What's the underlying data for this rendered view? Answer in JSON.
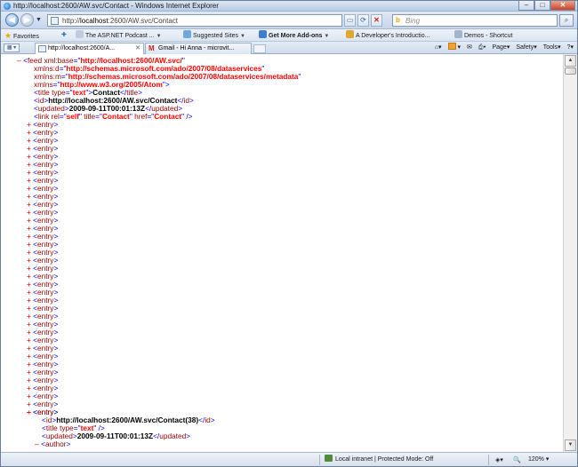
{
  "window": {
    "title": "http://localhost:2600/AW.svc/Contact - Windows Internet Explorer",
    "minimize": "–",
    "maximize": "□",
    "close": "✕"
  },
  "address": {
    "url_prefix": "http://",
    "url_host": "localhost",
    "url_rest": ":2600/AW.svc/Contact",
    "search_placeholder": "Bing"
  },
  "favorites": {
    "favorites_label": "Favorites",
    "items": [
      {
        "label": "The ASP.NET Podcast ...",
        "icon": "podcast-icon"
      },
      {
        "label": "Suggested Sites",
        "icon": "suggested-sites-icon"
      },
      {
        "label": "Get More Add-ons",
        "icon": "addons-icon"
      },
      {
        "label": "A Developer's Introductio...",
        "icon": "page-icon"
      },
      {
        "label": "Demos - Shortcut",
        "icon": "page-icon"
      }
    ]
  },
  "tabs": [
    {
      "label": "http://localhost:2600/A...",
      "active": true
    },
    {
      "label": "Gmail - Hi Anna - microvit...",
      "active": false
    }
  ],
  "commands": {
    "page": "Page",
    "safety": "Safety",
    "tools": "Tools",
    "help": "?"
  },
  "xml": {
    "feed_open": "feed",
    "attr_base_name": "xml:base",
    "attr_base_value": "http://localhost:2600/AW.svc/",
    "attr_d_name": "xmlns:d",
    "attr_d_value": "http://schemas.microsoft.com/ado/2007/08/dataservices",
    "attr_m_name": "xmlns:m",
    "attr_m_value": "http://schemas.microsoft.com/ado/2007/08/dataservices/metadata",
    "attr_xmlns_name": "xmlns",
    "attr_xmlns_value": "http://www.w3.org/2005/Atom",
    "title_tag": "title",
    "title_type_name": "type",
    "title_type_value": "text",
    "title_text": "Contact",
    "id_tag": "id",
    "id_text": "http://localhost:2600/AW.svc/Contact",
    "updated_tag": "updated",
    "updated_text": "2009-09-11T00:01:13Z",
    "link_tag": "link",
    "link_rel_name": "rel",
    "link_rel_value": "self",
    "link_title_name": "title",
    "link_title_value": "Contact",
    "link_href_name": "href",
    "link_href_value": "Contact",
    "entry_tag": "entry",
    "collapsed_entry_count": 37,
    "expanded_entry": {
      "id_text": "http://localhost:2600/AW.svc/Contact(38)",
      "title_type_value": "text",
      "updated_text": "2009-09-11T00:01:13Z",
      "author_tag": "author"
    },
    "plus": "+",
    "minus": "–"
  },
  "status": {
    "zone": "Local intranet | Protected Mode: Off",
    "zoom": "120%"
  }
}
